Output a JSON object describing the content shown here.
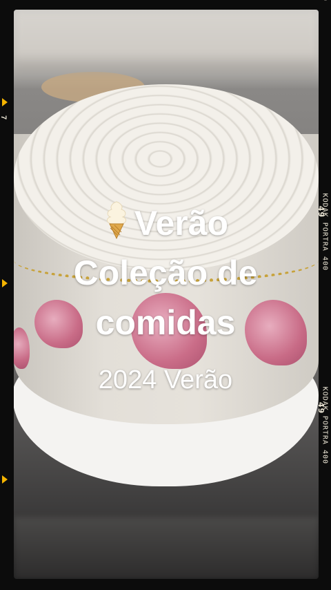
{
  "overlay": {
    "title_line1": "Verão",
    "title_line2": "Coleção de",
    "title_line3": "comidas",
    "subtitle": "2024 Verão"
  },
  "film": {
    "brand_label": "KODAK PORTRA 400",
    "frame_number_right": "49",
    "frame_number_left": "7"
  },
  "icons": {
    "title_icon": "soft-serve-ice-cream-icon",
    "frame_marker": "film-frame-triangle-icon"
  },
  "colors": {
    "title_text": "#ffffff",
    "film_border": "#0c0c0c",
    "marker": "#f5b400"
  }
}
